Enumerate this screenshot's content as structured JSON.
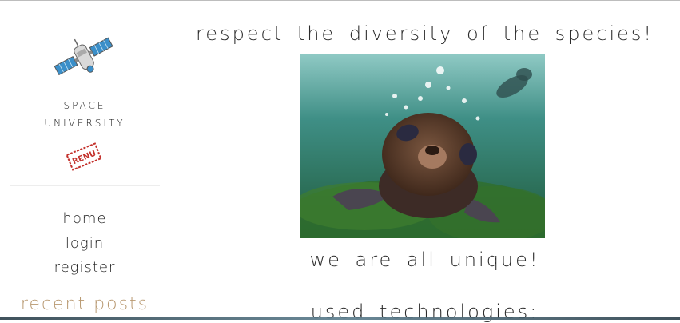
{
  "sidebar": {
    "logo_icon": "satellite-icon",
    "brand_line1": "SPACE",
    "brand_line2": "UNIVERSITY",
    "stamp_text": "RENU",
    "nav": [
      {
        "label": "home"
      },
      {
        "label": "login"
      },
      {
        "label": "register"
      }
    ],
    "recent_posts_heading": "recent posts"
  },
  "main": {
    "headline": "respect the diversity of the species!",
    "photo_icon": "sea-lion-photo",
    "caption": "we are all unique!",
    "section_heading": "used technologies:"
  },
  "colors": {
    "accent": "#b89870",
    "text": "#2b2b2b",
    "water": "#3f8f86"
  }
}
